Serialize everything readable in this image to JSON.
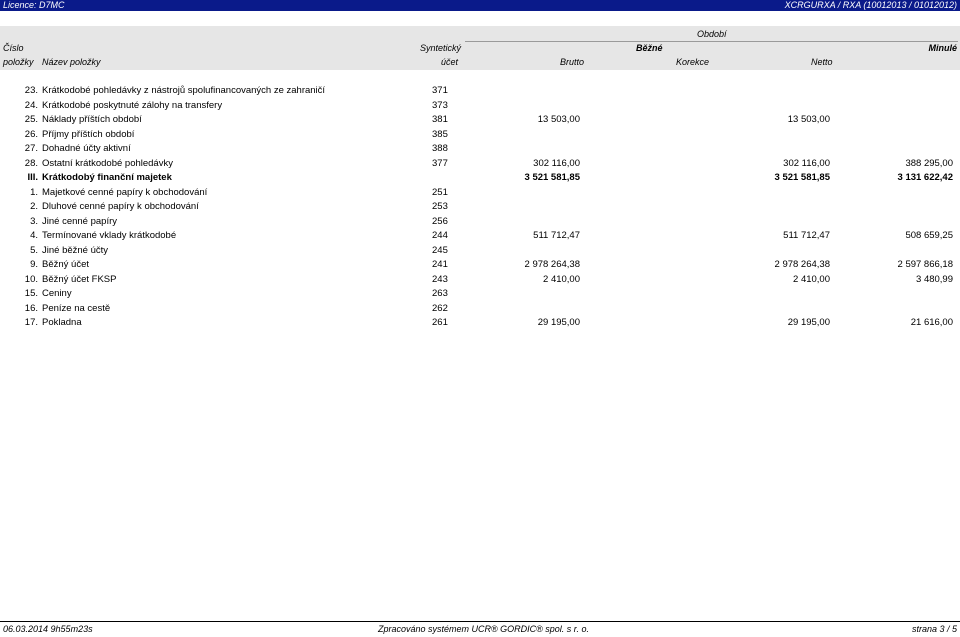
{
  "header_bar": {
    "licence": "Licence: D7MC",
    "report_id": "XCRGURXA / RXA  (10012013 / 01012012)"
  },
  "columns": {
    "cislo": "Číslo",
    "polozky": "položky",
    "nazev": "Název položky",
    "synteticky": "Syntetický",
    "ucet": "účet",
    "obdobi": "Období",
    "bezne": "Běžné",
    "minule": "Minulé",
    "brutto": "Brutto",
    "korekce": "Korekce",
    "netto": "Netto"
  },
  "rows": [
    {
      "num": "23.",
      "name": "Krátkodobé pohledávky z nástrojů spolufinancovaných ze zahraničí",
      "acct": "371",
      "brutto": "",
      "netto": "",
      "minule": ""
    },
    {
      "num": "24.",
      "name": "Krátkodobé poskytnuté zálohy na transfery",
      "acct": "373",
      "brutto": "",
      "netto": "",
      "minule": ""
    },
    {
      "num": "25.",
      "name": "Náklady příštích období",
      "acct": "381",
      "brutto": "13 503,00",
      "netto": "13 503,00",
      "minule": ""
    },
    {
      "num": "26.",
      "name": "Příjmy příštích období",
      "acct": "385",
      "brutto": "",
      "netto": "",
      "minule": ""
    },
    {
      "num": "27.",
      "name": "Dohadné účty aktivní",
      "acct": "388",
      "brutto": "",
      "netto": "",
      "minule": ""
    },
    {
      "num": "28.",
      "name": "Ostatní krátkodobé pohledávky",
      "acct": "377",
      "brutto": "302 116,00",
      "netto": "302 116,00",
      "minule": "388 295,00"
    },
    {
      "num": "III.",
      "name": "Krátkodobý finanční majetek",
      "acct": "",
      "brutto": "3 521 581,85",
      "netto": "3 521 581,85",
      "minule": "3 131 622,42",
      "bold": true
    },
    {
      "num": "1.",
      "name": "Majetkové cenné papíry k obchodování",
      "acct": "251",
      "brutto": "",
      "netto": "",
      "minule": ""
    },
    {
      "num": "2.",
      "name": "Dluhové cenné papíry k obchodování",
      "acct": "253",
      "brutto": "",
      "netto": "",
      "minule": ""
    },
    {
      "num": "3.",
      "name": "Jiné cenné papíry",
      "acct": "256",
      "brutto": "",
      "netto": "",
      "minule": ""
    },
    {
      "num": "4.",
      "name": "Termínované vklady krátkodobé",
      "acct": "244",
      "brutto": "511 712,47",
      "netto": "511 712,47",
      "minule": "508 659,25"
    },
    {
      "num": "5.",
      "name": "Jiné běžné účty",
      "acct": "245",
      "brutto": "",
      "netto": "",
      "minule": ""
    },
    {
      "num": "9.",
      "name": "Běžný účet",
      "acct": "241",
      "brutto": "2 978 264,38",
      "netto": "2 978 264,38",
      "minule": "2 597 866,18"
    },
    {
      "num": "10.",
      "name": "Běžný účet FKSP",
      "acct": "243",
      "brutto": "2 410,00",
      "netto": "2 410,00",
      "minule": "3 480,99"
    },
    {
      "num": "15.",
      "name": "Ceniny",
      "acct": "263",
      "brutto": "",
      "netto": "",
      "minule": ""
    },
    {
      "num": "16.",
      "name": "Peníze na cestě",
      "acct": "262",
      "brutto": "",
      "netto": "",
      "minule": ""
    },
    {
      "num": "17.",
      "name": "Pokladna",
      "acct": "261",
      "brutto": "29 195,00",
      "netto": "29 195,00",
      "minule": "21 616,00"
    }
  ],
  "footer": {
    "timestamp": "06.03.2014 9h55m23s",
    "processed_by": "Zpracováno systémem  UCR® GORDIC® spol. s  r. o.",
    "page": "strana 3 / 5"
  }
}
